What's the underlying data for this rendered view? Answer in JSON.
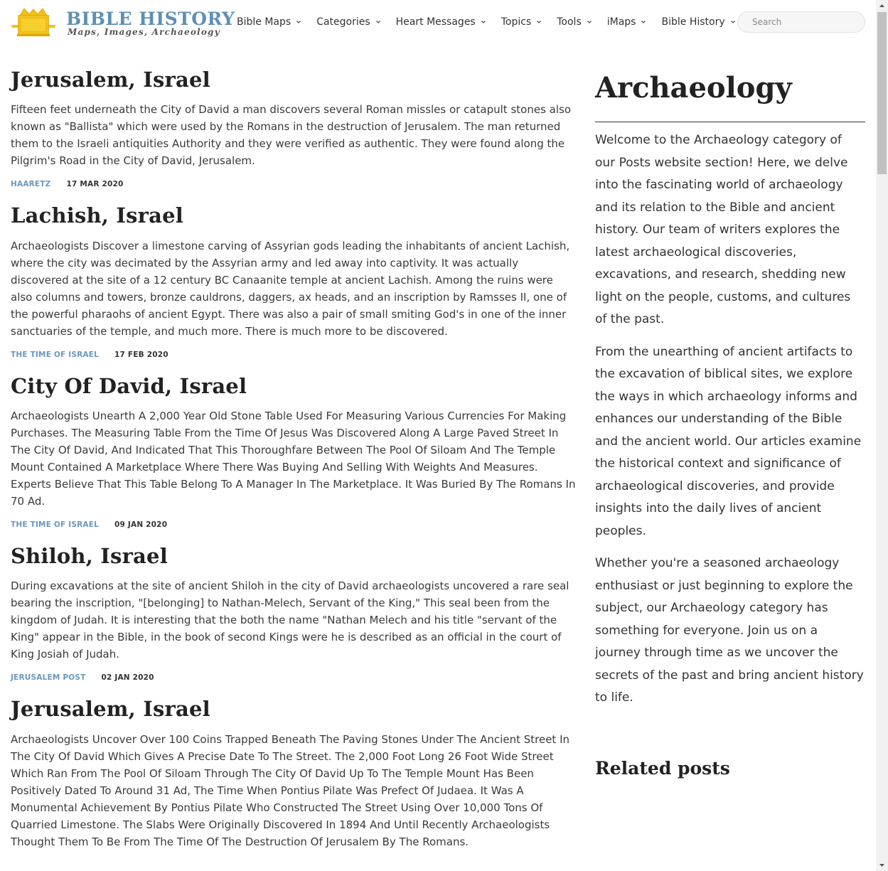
{
  "header": {
    "logo_title": "BIBLE HISTORY",
    "logo_tagline": "Maps, Images, Archaeology",
    "logo_icon": "ark-of-covenant-icon",
    "nav": [
      {
        "label": "Bible Maps"
      },
      {
        "label": "Categories"
      },
      {
        "label": "Heart Messages"
      },
      {
        "label": "Topics"
      },
      {
        "label": "Tools"
      },
      {
        "label": "iMaps"
      },
      {
        "label": "Bible History"
      }
    ],
    "search_placeholder": "Search"
  },
  "posts": [
    {
      "title": "Jerusalem, Israel",
      "body": "Fifteen feet underneath the City of David a man discovers several Roman missles or catapult stones also known as \"Ballista\" which were used by the Romans in the destruction of Jerusalem. The man returned them to the Israeli antiquities Authority and they were verified as authentic. They were found along the Pilgrim's Road in the City of David, Jerusalem.",
      "source": "HAARETZ",
      "date": "17 MAR 2020"
    },
    {
      "title": "Lachish, Israel",
      "body": "Archaeologists Discover a limestone carving of Assyrian gods leading the inhabitants of ancient Lachish, where the city was decimated by the Assyrian army and led away into captivity. It was actually discovered at the site of a 12 century BC Canaanite temple at ancient Lachish. Among the ruins were also columns and towers, bronze cauldrons, daggers, ax heads, and an inscription by Ramsses II, one of the powerful pharaohs of ancient Egypt. There was also a pair of small smiting God's in one of the inner sanctuaries of the temple, and much more. There is much more to be discovered.",
      "source": "THE TIME OF ISRAEL",
      "date": "17 FEB 2020"
    },
    {
      "title": "City Of David, Israel",
      "body": "Archaeologists Unearth A 2,000 Year Old Stone Table Used For Measuring Various Currencies For Making Purchases. The Measuring Table From the Time Of Jesus Was Discovered Along A Large Paved Street In The City Of David, And Indicated That This Thoroughfare Between The Pool Of Siloam And The Temple Mount Contained A Marketplace Where There Was Buying And Selling With Weights And Measures. Experts Believe That This Table Belong To A Manager In The Marketplace. It Was Buried By The Romans In 70 Ad.",
      "source": "THE TIME OF ISRAEL",
      "date": "09 JAN 2020"
    },
    {
      "title": "Shiloh, Israel",
      "body": "During excavations at the site of ancient Shiloh in the city of David archaeologists uncovered a rare seal bearing the inscription, \"[belonging] to Nathan-Melech, Servant of the King,\" This seal been from the kingdom of Judah. It is interesting that the both the name \"Nathan Melech and his title \"servant of the King\" appear in the Bible, in the book of second Kings were he is described as an official in the court of King Josiah of Judah.",
      "source": "JERUSALEM POST",
      "date": "02 JAN 2020"
    },
    {
      "title": "Jerusalem, Israel",
      "body": "Archaeologists Uncover Over 100 Coins Trapped Beneath The Paving Stones Under The Ancient Street In The City Of David Which Gives A Precise Date To The Street. The 2,000 Foot Long 26 Foot Wide Street Which Ran From The Pool Of Siloam Through The City Of David Up To The Temple Mount Has Been Positively Dated To Around 31 Ad, The Time When Pontius Pilate Was Prefect Of Judaea. It Was A Monumental Achievement By Pontius Pilate Who Constructed The Street Using Over 10,000 Tons Of Quarried Limestone. The Slabs Were Originally Discovered In 1894 And Until Recently Archaeologists Thought Them To Be From The Time Of The Destruction Of Jerusalem By The Romans.",
      "source": "",
      "date": ""
    }
  ],
  "sidebar": {
    "title": "Archaeology",
    "paragraphs": [
      "Welcome to the Archaeology category of our Posts website section! Here, we delve into the fascinating world of archaeology and its relation to the Bible and ancient history. Our team of writers explores the latest archaeological discoveries, excavations, and research, shedding new light on the people, customs, and cultures of the past.",
      "From the unearthing of ancient artifacts to the excavation of biblical sites, we explore the ways in which archaeology informs and enhances our understanding of the Bible and the ancient world. Our articles examine the historical context and significance of archaeological discoveries, and provide insights into the daily lives of ancient peoples.",
      "Whether you're a seasoned archaeology enthusiast or just beginning to explore the subject, our Archaeology category has something for everyone. Join us on a journey through time as we uncover the secrets of the past and bring ancient history to life."
    ],
    "related_title": "Related posts"
  },
  "colors": {
    "brand": "#5f8fb4",
    "source_link": "#6a98bd",
    "logo_gold": "#f2c21a"
  }
}
